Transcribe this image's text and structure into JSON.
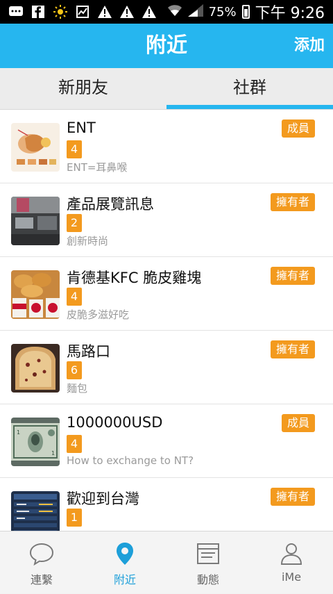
{
  "status_bar": {
    "battery": "75%",
    "time": "下午 9:26"
  },
  "app_bar": {
    "title": "附近",
    "action": "添加"
  },
  "tabs": [
    {
      "label": "新朋友",
      "active": false
    },
    {
      "label": "社群",
      "active": true
    }
  ],
  "groups": [
    {
      "name": "ENT",
      "count": "4",
      "desc": "ENT=耳鼻喉",
      "role": "成員",
      "icon": "ent-anatomy-thumbnail"
    },
    {
      "name": "產品展覽訊息",
      "count": "2",
      "desc": "創新時尚",
      "role": "擁有者",
      "icon": "exhibition-thumbnail"
    },
    {
      "name": "肯德基KFC 脆皮雞塊",
      "count": "4",
      "desc": "皮脆多滋好吃",
      "role": "擁有者",
      "icon": "kfc-nuggets-thumbnail"
    },
    {
      "name": "馬路口",
      "count": "6",
      "desc": "麵包",
      "role": "擁有者",
      "icon": "bread-thumbnail"
    },
    {
      "name": "1000000USD",
      "count": "4",
      "desc": "How to exchange to NT?",
      "role": "成員",
      "icon": "dollar-bill-thumbnail"
    },
    {
      "name": "歡迎到台灣",
      "count": "1",
      "desc": "",
      "role": "擁有者",
      "icon": "airport-board-thumbnail"
    }
  ],
  "bottom_nav": [
    {
      "label": "連繫",
      "icon": "chat-bubble-icon",
      "active": false
    },
    {
      "label": "附近",
      "icon": "location-pin-icon",
      "active": true
    },
    {
      "label": "動態",
      "icon": "feed-icon",
      "active": false
    },
    {
      "label": "iMe",
      "icon": "profile-icon",
      "active": false
    }
  ],
  "colors": {
    "primary": "#26b6ef",
    "badge": "#f39a1e",
    "active_nav": "#1d9fd9"
  }
}
